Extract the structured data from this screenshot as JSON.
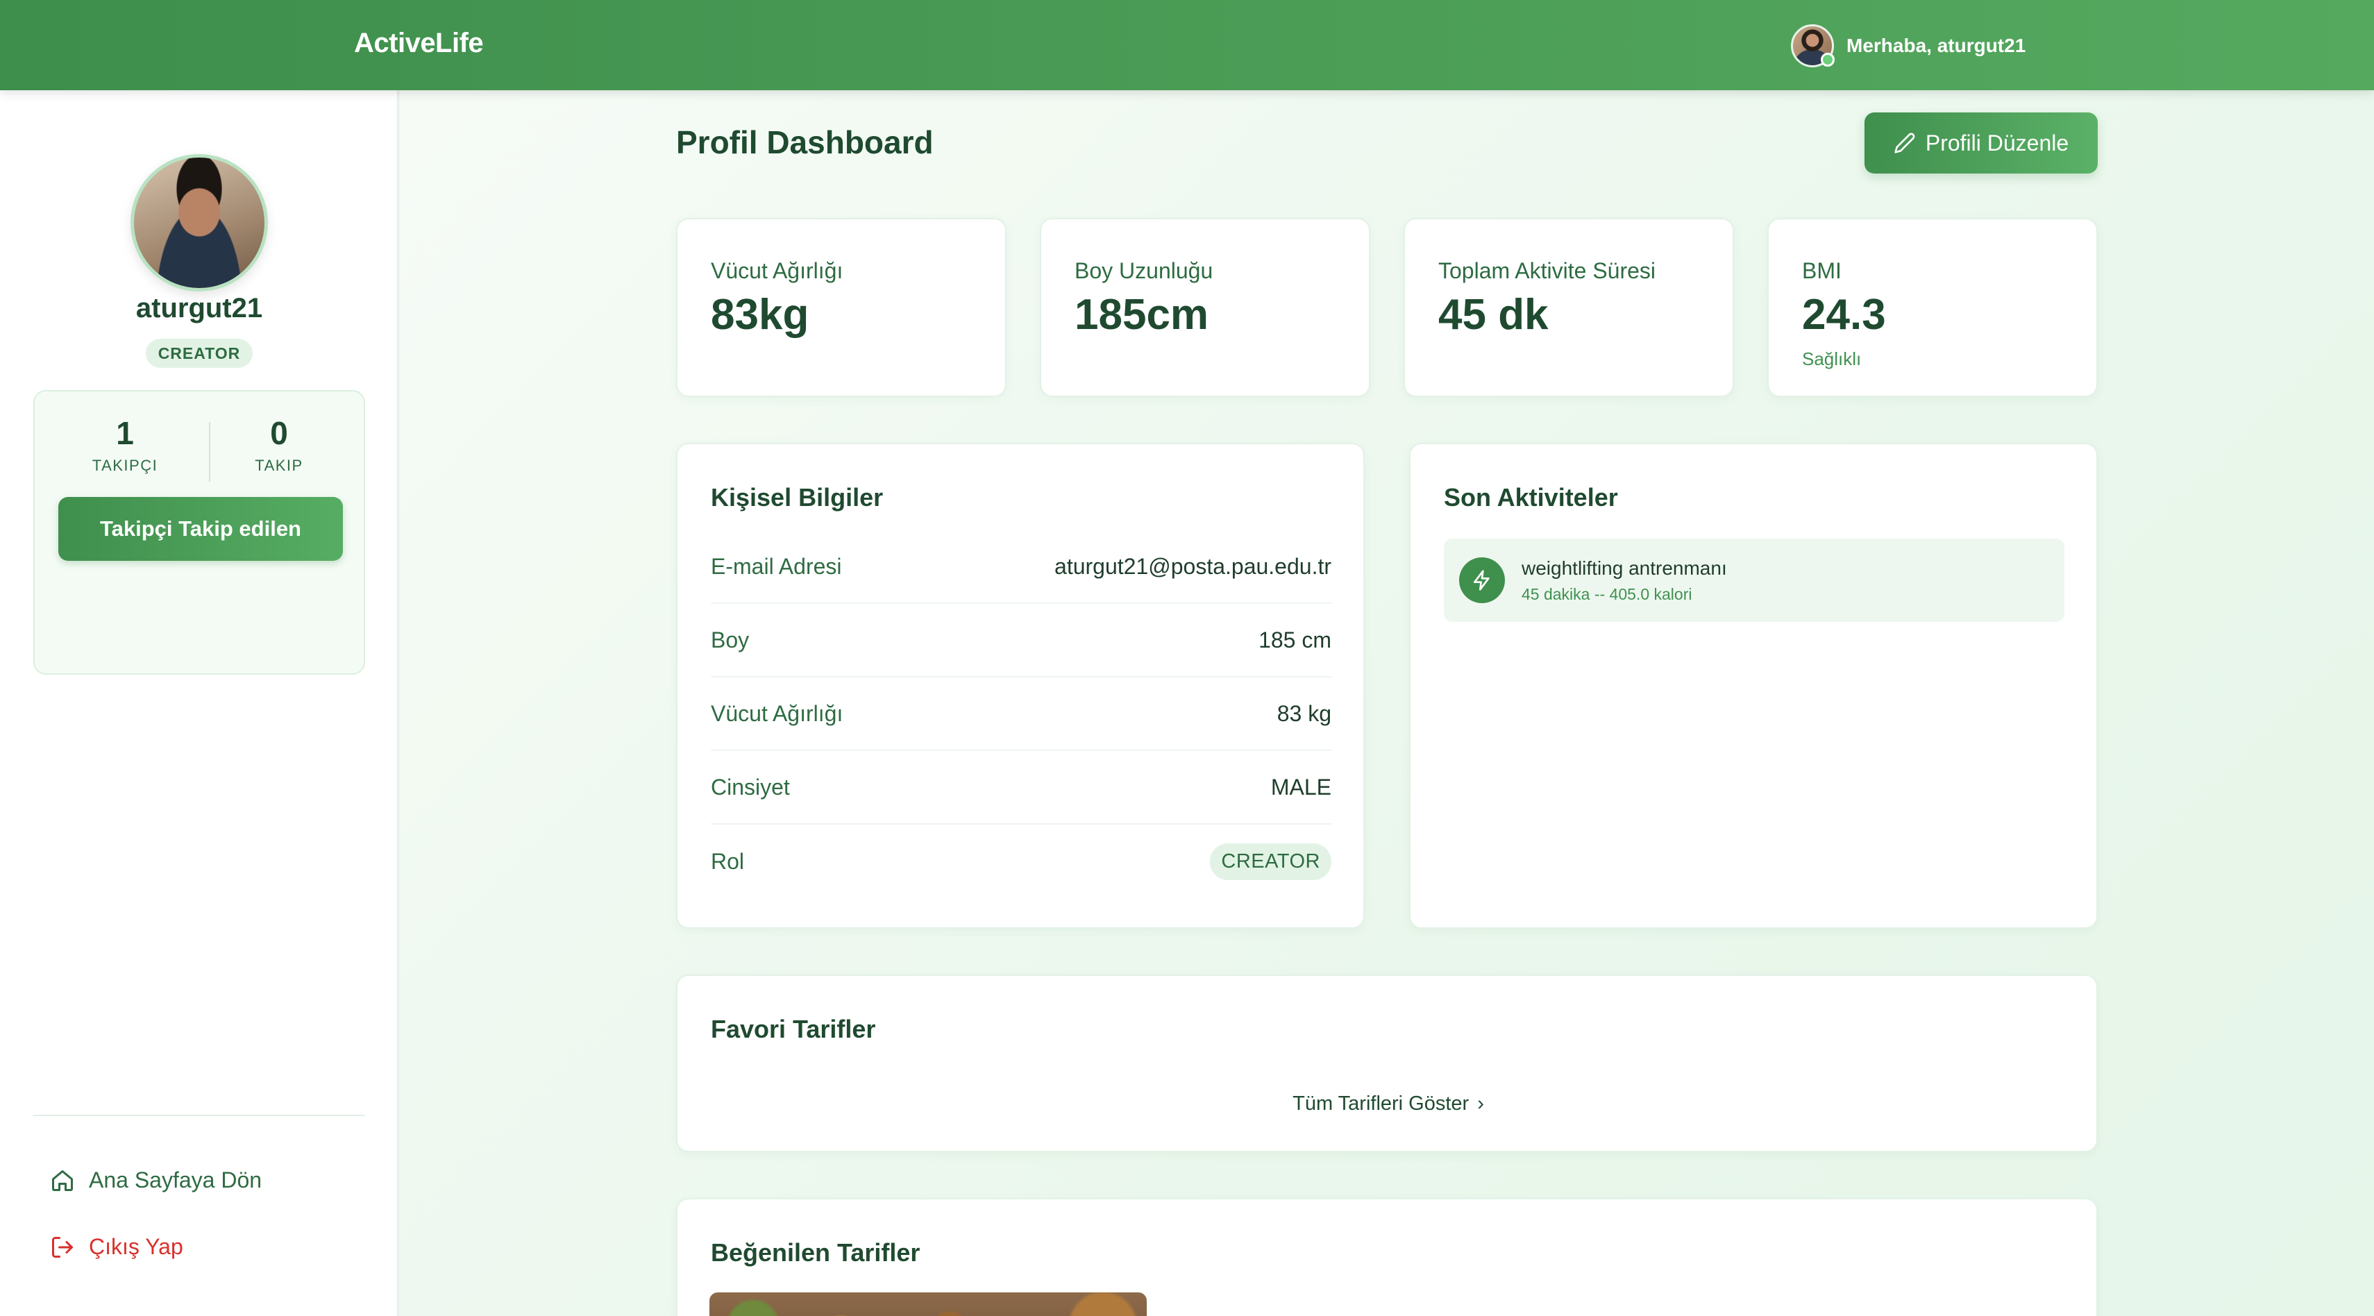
{
  "header": {
    "brand": "ActiveLife",
    "greeting": "Merhaba, aturgut21"
  },
  "sidebar": {
    "username": "aturgut21",
    "role_badge": "CREATOR",
    "followers_count": "1",
    "followers_label": "TAKIPÇI",
    "following_count": "0",
    "following_label": "TAKIP",
    "follow_button": "Takipçi Takip edilen",
    "home_link": "Ana Sayfaya Dön",
    "logout_link": "Çıkış Yap"
  },
  "main": {
    "title": "Profil Dashboard",
    "edit_button": "Profili Düzenle",
    "stats": [
      {
        "label": "Vücut Ağırlığı",
        "value": "83kg",
        "sub": ""
      },
      {
        "label": "Boy Uzunluğu",
        "value": "185cm",
        "sub": ""
      },
      {
        "label": "Toplam Aktivite Süresi",
        "value": "45 dk",
        "sub": ""
      },
      {
        "label": "BMI",
        "value": "24.3",
        "sub": "Sağlıklı"
      }
    ],
    "personal": {
      "title": "Kişisel Bilgiler",
      "rows": [
        {
          "key": "E-mail Adresi",
          "value": "aturgut21@posta.pau.edu.tr"
        },
        {
          "key": "Boy",
          "value": "185 cm"
        },
        {
          "key": "Vücut Ağırlığı",
          "value": "83 kg"
        },
        {
          "key": "Cinsiyet",
          "value": "MALE"
        },
        {
          "key": "Rol",
          "value": "CREATOR"
        }
      ]
    },
    "activities": {
      "title": "Son Aktiviteler",
      "items": [
        {
          "name": "weightlifting antrenmanı",
          "meta": "45 dakika -- 405.0 kalori"
        }
      ]
    },
    "favorites": {
      "title": "Favori Tarifler",
      "show_all": "Tüm Tarifleri Göster"
    },
    "liked": {
      "title": "Beğenilen Tarifler"
    }
  },
  "colors": {
    "brand_green": "#3f8f4d",
    "light_green_bg": "#eef7ef",
    "logout_red": "#d9302c"
  },
  "icons": [
    "pencil-icon",
    "home-icon",
    "logout-icon",
    "lightning-icon",
    "chevron-right-icon"
  ]
}
